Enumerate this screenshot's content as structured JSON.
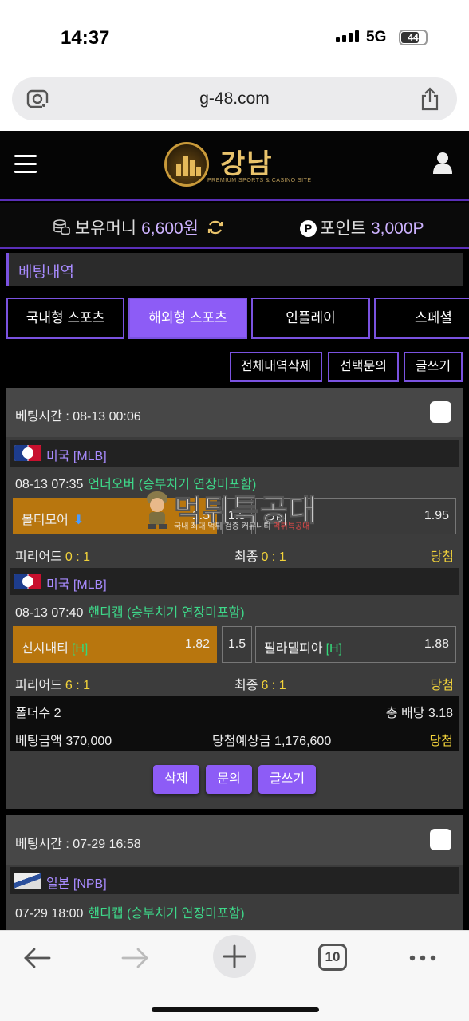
{
  "status_bar": {
    "time": "14:37",
    "network": "5G",
    "battery": "44"
  },
  "browser": {
    "url": "g-48.com",
    "tab_count": "10"
  },
  "header": {
    "logo_name": "강남",
    "logo_sub": "PREMIUM SPORTS & CASINO SITE"
  },
  "wallet": {
    "money_label": "보유머니",
    "money_value": "6,600원",
    "point_badge": "P",
    "point_label": "포인트",
    "point_value": "3,000P"
  },
  "section_title": "베팅내역",
  "tabs": [
    {
      "label": "국내형 스포츠"
    },
    {
      "label": "해외형 스포츠"
    },
    {
      "label": "인플레이"
    },
    {
      "label": "스페셜"
    }
  ],
  "actions": {
    "delete_all": "전체내역삭제",
    "select_inquiry": "선택문의",
    "write": "글쓰기"
  },
  "bets": [
    {
      "time_label": "베팅시간 : 08-13 00:06",
      "games": [
        {
          "league": "미국 [MLB]",
          "datetime": "08-13 07:35",
          "market": "언더오버 (승부치기 연장미포함)",
          "home": "볼티모어",
          "home_odds": "1.5",
          "line": "1.5",
          "away": "오버",
          "away_odds": "1.95",
          "period_label": "피리어드",
          "period_score": "0 : 1",
          "final_label": "최종",
          "final_score": "0 : 1",
          "result": "당첨"
        },
        {
          "league": "미국 [MLB]",
          "datetime": "08-13 07:40",
          "market": "핸디캡 (승부치기 연장미포함)",
          "home": "신시내티",
          "home_tag": "[H]",
          "home_odds": "1.82",
          "line": "1.5",
          "away": "필라델피아",
          "away_tag": "[H]",
          "away_odds": "1.88",
          "period_label": "피리어드",
          "period_score": "6 : 1",
          "final_label": "최종",
          "final_score": "6 : 1",
          "result": "당첨"
        }
      ],
      "summary": {
        "folders": "폴더수 2",
        "total_odds": "총 배당 3.18",
        "bet_amount": "베팅금액 370,000",
        "expected": "당첨예상금 1,176,600",
        "result": "당첨"
      },
      "buttons": {
        "delete": "삭제",
        "inquiry": "문의",
        "write": "글쓰기"
      }
    },
    {
      "time_label": "베팅시간 : 07-29 16:58",
      "games": [
        {
          "league": "일본 [NPB]",
          "datetime": "07-29 18:00",
          "market": "핸디캡 (승부치기 연장미포함)"
        }
      ]
    }
  ],
  "watermark": {
    "title": "먹튀특공대",
    "sub_a": "국내 최대 먹튀 검증 커뮤니티",
    "sub_b": "먹튀특공대"
  }
}
